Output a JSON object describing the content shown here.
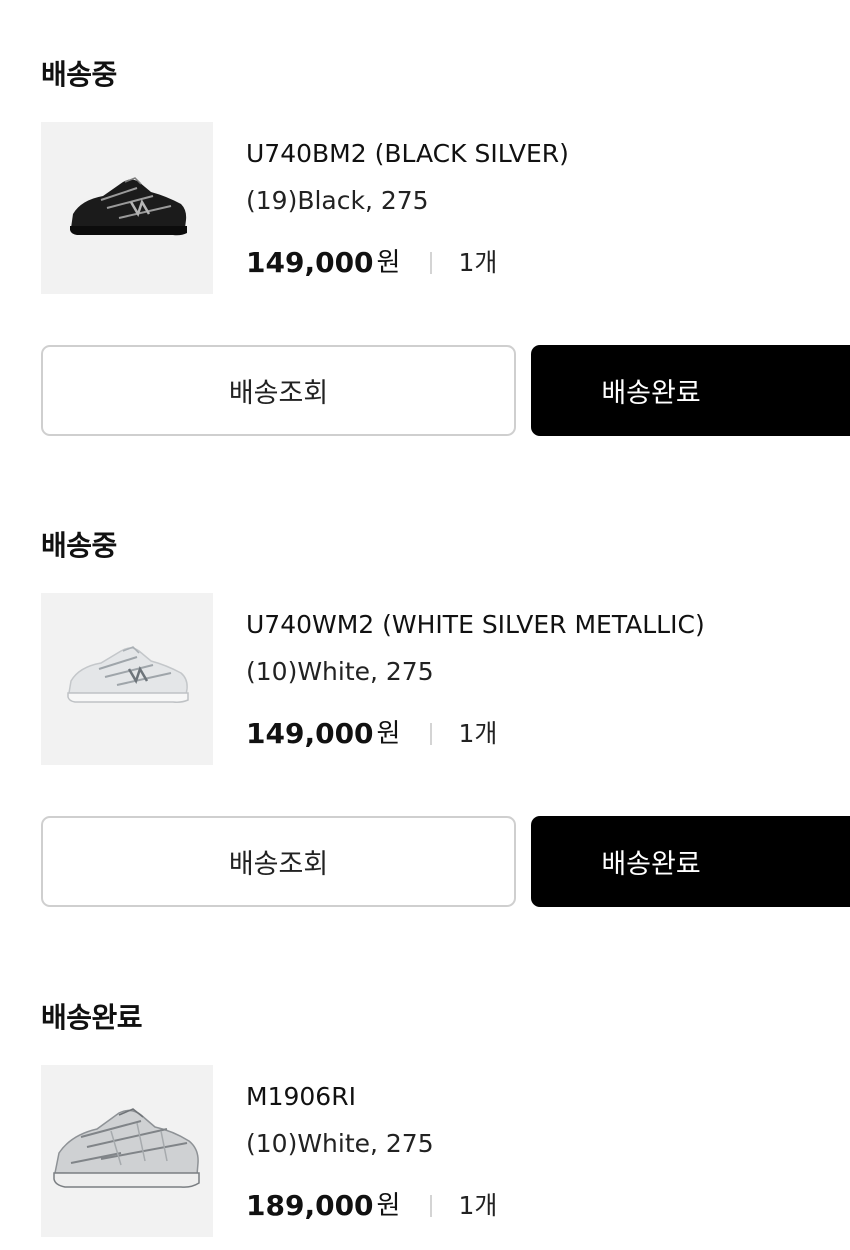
{
  "orders": [
    {
      "status": "배송중",
      "product_name": "U740BM2 (BLACK SILVER)",
      "option": "(19)Black, 275",
      "price": "149,000",
      "currency": "원",
      "quantity": "1개",
      "shoe_color": "black",
      "buttons": {
        "track": "배송조회",
        "complete": "배송완료"
      }
    },
    {
      "status": "배송중",
      "product_name": "U740WM2 (WHITE SILVER METALLIC)",
      "option": "(10)White, 275",
      "price": "149,000",
      "currency": "원",
      "quantity": "1개",
      "shoe_color": "white",
      "buttons": {
        "track": "배송조회",
        "complete": "배송완료"
      }
    },
    {
      "status": "배송완료",
      "product_name": "M1906RI",
      "option": "(10)White, 275",
      "price": "189,000",
      "currency": "원",
      "quantity": "1개",
      "shoe_color": "silver"
    }
  ],
  "colors": {
    "primary_button_bg": "#000000",
    "secondary_button_border": "#cfcfcf",
    "thumbnail_bg": "#f2f2f2"
  }
}
